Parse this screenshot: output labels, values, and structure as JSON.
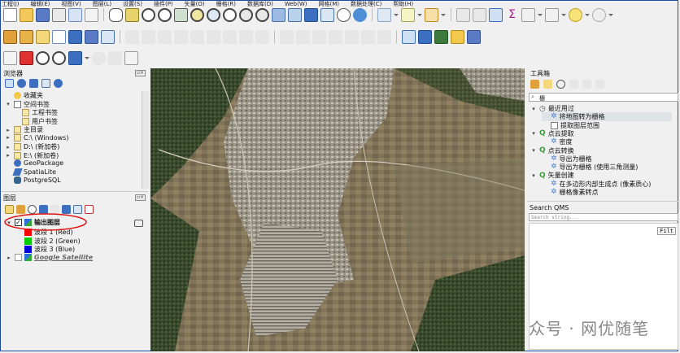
{
  "menu": [
    "工程(J)",
    "编辑(E)",
    "视图(V)",
    "图层(L)",
    "设置(S)",
    "插件(P)",
    "矢量(O)",
    "栅格(R)",
    "数据库(D)",
    "Web(W)",
    "网格(M)",
    "数据处理(C)",
    "帮助(H)"
  ],
  "browser": {
    "title": "浏览器",
    "items": [
      {
        "label": "收藏夹",
        "indent": 0,
        "expand": "",
        "icon": "star-icon"
      },
      {
        "label": "空间书签",
        "indent": 0,
        "expand": "▾",
        "icon": "bookmark-icon"
      },
      {
        "label": "工程书签",
        "indent": 1,
        "expand": "",
        "icon": "folder-icon"
      },
      {
        "label": "用户书签",
        "indent": 1,
        "expand": "",
        "icon": "folder-icon"
      },
      {
        "label": "主目录",
        "indent": 0,
        "expand": "▸",
        "icon": "home-icon"
      },
      {
        "label": "C:\\ (Windows)",
        "indent": 0,
        "expand": "▸",
        "icon": "folder-icon"
      },
      {
        "label": "D:\\ (新加卷)",
        "indent": 0,
        "expand": "▸",
        "icon": "folder-icon"
      },
      {
        "label": "E:\\ (新加卷)",
        "indent": 0,
        "expand": "▸",
        "icon": "folder-icon"
      },
      {
        "label": "GeoPackage",
        "indent": 0,
        "expand": "",
        "icon": "geopackage-icon"
      },
      {
        "label": "SpatiaLite",
        "indent": 0,
        "expand": "",
        "icon": "feather-icon"
      },
      {
        "label": "PostgreSQL",
        "indent": 0,
        "expand": "",
        "icon": "elephant-icon"
      }
    ]
  },
  "layers": {
    "title": "图层",
    "output_layer": "输出图层",
    "bands": [
      {
        "label": "波段 1 (Red)",
        "color": "#ff0000"
      },
      {
        "label": "波段 2 (Green)",
        "color": "#00cc00"
      },
      {
        "label": "波段 3 (Blue)",
        "color": "#0000dd"
      }
    ],
    "google_layer": "Google Satellite"
  },
  "toolbox": {
    "title": "工具箱",
    "search_value": "栅",
    "tree": [
      {
        "label": "最近用过",
        "level": 0,
        "icon": "clock-icon"
      },
      {
        "label": "将地图转为栅格",
        "level": 1,
        "icon": "gear-icon",
        "selected": true
      },
      {
        "label": "提取图层范围",
        "level": 1,
        "icon": "table-icon"
      },
      {
        "label": "点云提取",
        "level": 0,
        "icon": "qgis-icon"
      },
      {
        "label": "密度",
        "level": 1,
        "icon": "gear-icon"
      },
      {
        "label": "点云转换",
        "level": 0,
        "icon": "qgis-icon"
      },
      {
        "label": "导出为栅格",
        "level": 1,
        "icon": "gear-icon"
      },
      {
        "label": "导出为栅格 (使用三角测量)",
        "level": 1,
        "icon": "gear-icon"
      },
      {
        "label": "矢量创建",
        "level": 0,
        "icon": "qgis-icon"
      },
      {
        "label": "在多边形内部生成点 (像素质心)",
        "level": 1,
        "icon": "gear-icon"
      },
      {
        "label": "栅格像素转点",
        "level": 1,
        "icon": "gear-icon"
      }
    ]
  },
  "qms": {
    "title": "Search QMS",
    "placeholder": "Search string...",
    "filter_label": "Filt"
  },
  "watermark": "众号 · 网优随笔",
  "annotation_color": "#e01010"
}
